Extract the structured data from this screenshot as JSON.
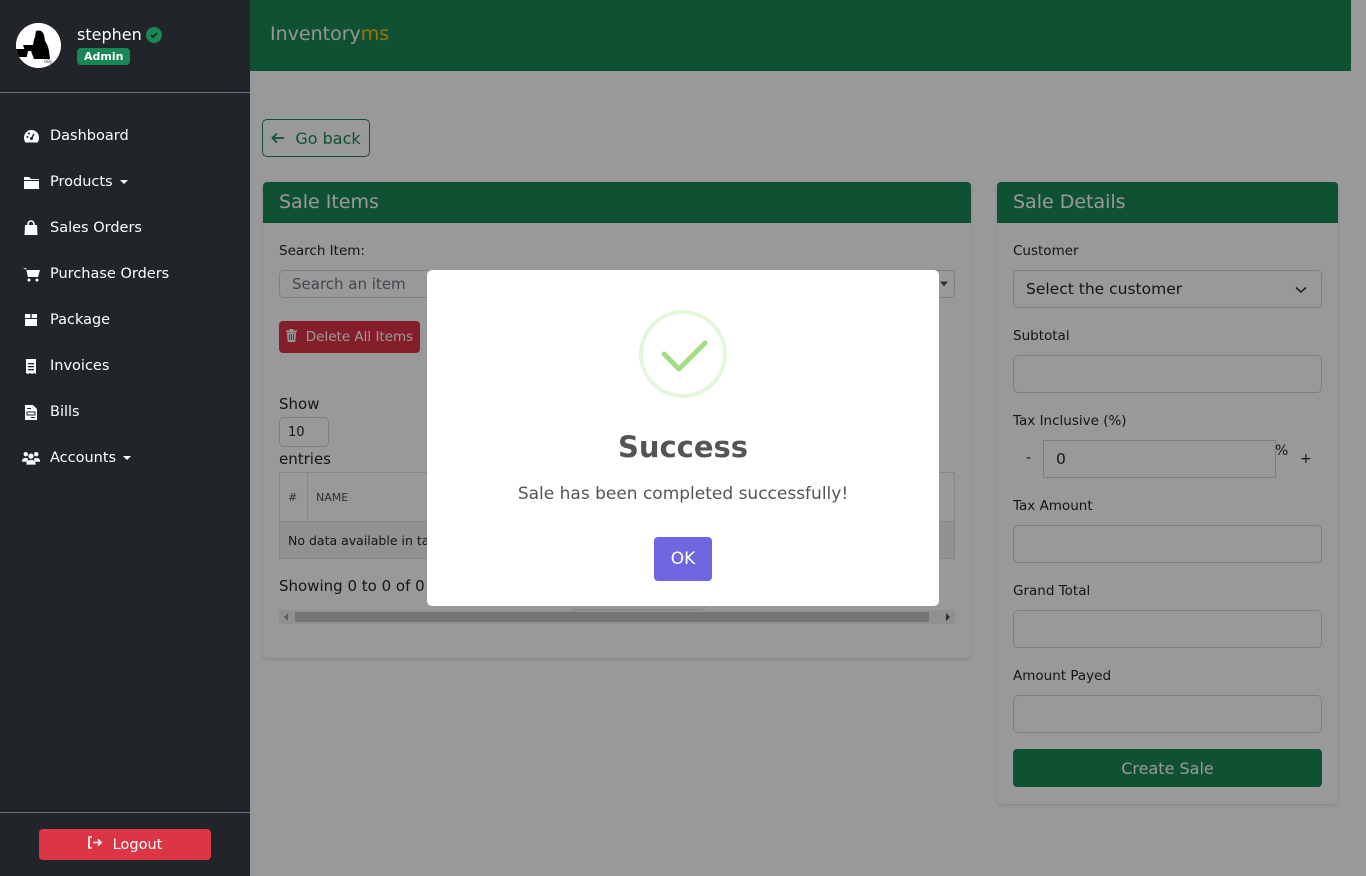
{
  "user": {
    "name": "stephen",
    "role": "Admin"
  },
  "sidebar": {
    "items": [
      {
        "label": "Dashboard",
        "icon": "gauge-icon",
        "dropdown": false
      },
      {
        "label": "Products",
        "icon": "folder-icon",
        "dropdown": true
      },
      {
        "label": "Sales Orders",
        "icon": "shopping-bag-icon",
        "dropdown": false
      },
      {
        "label": "Purchase Orders",
        "icon": "cart-icon",
        "dropdown": false
      },
      {
        "label": "Package",
        "icon": "box-icon",
        "dropdown": false
      },
      {
        "label": "Invoices",
        "icon": "receipt-icon",
        "dropdown": false
      },
      {
        "label": "Bills",
        "icon": "file-invoice-icon",
        "dropdown": false
      },
      {
        "label": "Accounts",
        "icon": "users-icon",
        "dropdown": true
      }
    ],
    "logout_label": "Logout"
  },
  "header": {
    "brand_main": "Inventory",
    "brand_accent": "ms"
  },
  "go_back_label": "Go back",
  "sale_items": {
    "title": "Sale Items",
    "search_label": "Search Item:",
    "search_placeholder": "Search an item",
    "delete_all_label": "Delete All Items",
    "show_label": "Show",
    "page_length": "10",
    "entries_label": "entries",
    "columns": [
      "#",
      "NAME"
    ],
    "empty_text": "No data available in table",
    "info_text": "Showing 0 to 0 of 0 entries"
  },
  "sale_details": {
    "title": "Sale Details",
    "customer_label": "Customer",
    "customer_selected": "Select the customer",
    "subtotal_label": "Subtotal",
    "subtotal_value": "",
    "tax_label": "Tax Inclusive (%)",
    "tax_value": "0",
    "tax_minus": "-",
    "tax_plus": "+",
    "tax_suffix": "%",
    "tax_amount_label": "Tax Amount",
    "tax_amount_value": "",
    "grand_total_label": "Grand Total",
    "grand_total_value": "",
    "amount_payed_label": "Amount Payed",
    "amount_payed_value": "",
    "create_label": "Create Sale"
  },
  "modal": {
    "title": "Success",
    "text": "Sale has been completed successfully!",
    "ok_label": "OK"
  },
  "colors": {
    "primary_green": "#1b8755",
    "danger": "#dc3545",
    "brand_accent": "#ffc107",
    "modal_confirm": "#7066e0",
    "success_check": "#a5dc86"
  }
}
